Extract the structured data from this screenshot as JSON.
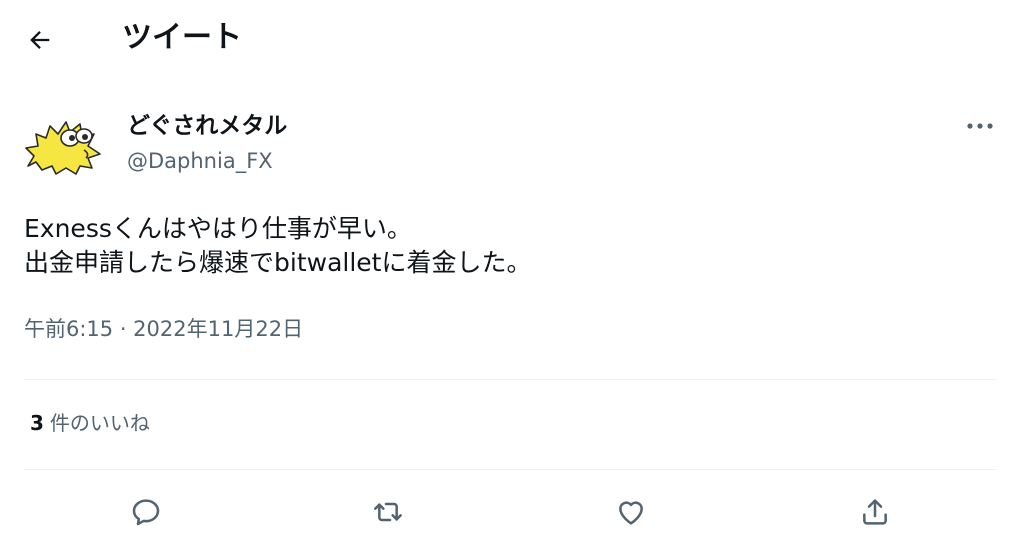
{
  "header": {
    "title": "ツイート",
    "back_icon": "arrow-left-icon"
  },
  "author": {
    "display_name": "どぐされメタル",
    "handle": "@Daphnia_FX",
    "avatar_icon": "yellow-pufferfish-avatar"
  },
  "tweet": {
    "lines": [
      "Exnessくんはやはり仕事が早い。",
      "出金申請したら爆速でbitwalletに着金した。"
    ],
    "timestamp": "午前6:15 · 2022年11月22日"
  },
  "stats": {
    "likes_count": "3",
    "likes_label": "件のいいね"
  },
  "actions": [
    {
      "name": "reply",
      "icon": "speech-bubble-icon"
    },
    {
      "name": "retweet",
      "icon": "retweet-arrows-icon"
    },
    {
      "name": "like",
      "icon": "heart-icon"
    },
    {
      "name": "share",
      "icon": "upload-arrow-icon"
    }
  ],
  "colors": {
    "text": "#0f1419",
    "secondary": "#536471",
    "divider": "#eff3f4",
    "avatar_yellow": "#f5e642"
  }
}
